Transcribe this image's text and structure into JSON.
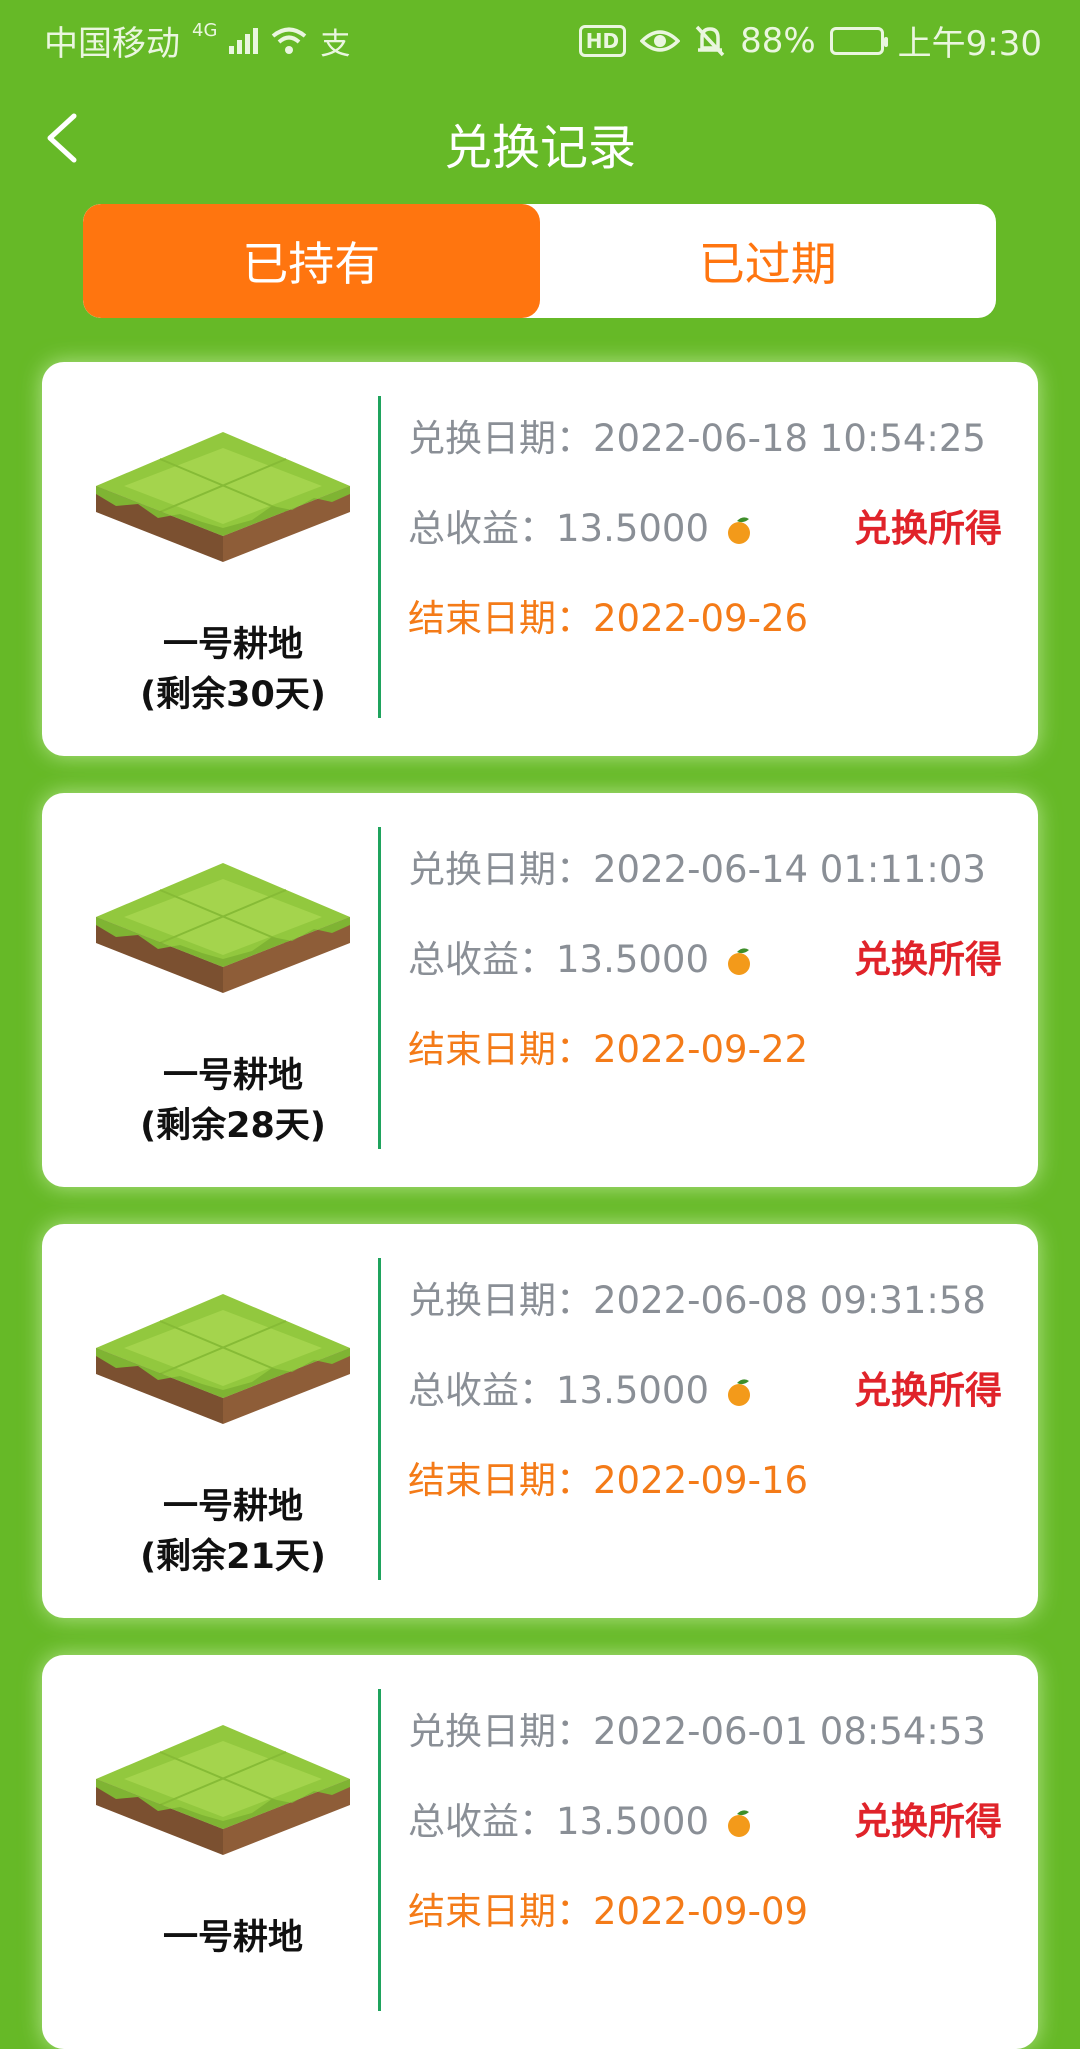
{
  "status_bar": {
    "carrier": "中国移动",
    "network": "4G",
    "extra_icon": "支",
    "hd": "HD",
    "battery": "88%",
    "time": "上午9:30"
  },
  "header": {
    "title": "兑换记录"
  },
  "tabs": [
    {
      "label": "已持有",
      "active": true
    },
    {
      "label": "已过期",
      "active": false
    }
  ],
  "labels": {
    "exchange_date": "兑换日期：",
    "total_income": "总收益：",
    "end_date": "结束日期：",
    "redeem": "兑换所得"
  },
  "records": [
    {
      "name": "一号耕地",
      "remaining": "(剩余30天)",
      "exchange_date": "2022-06-18 10:54:25",
      "income": "13.5000",
      "end_date": "2022-09-26"
    },
    {
      "name": "一号耕地",
      "remaining": "(剩余28天)",
      "exchange_date": "2022-06-14 01:11:03",
      "income": "13.5000",
      "end_date": "2022-09-22"
    },
    {
      "name": "一号耕地",
      "remaining": "(剩余21天)",
      "exchange_date": "2022-06-08 09:31:58",
      "income": "13.5000",
      "end_date": "2022-09-16"
    },
    {
      "name": "一号耕地",
      "remaining": "",
      "exchange_date": "2022-06-01 08:54:53",
      "income": "13.5000",
      "end_date": "2022-09-09"
    }
  ],
  "colors": {
    "background": "#66b927",
    "accent_orange": "#ff750f",
    "red": "#e0232a",
    "divider_green": "#1fa35d"
  }
}
